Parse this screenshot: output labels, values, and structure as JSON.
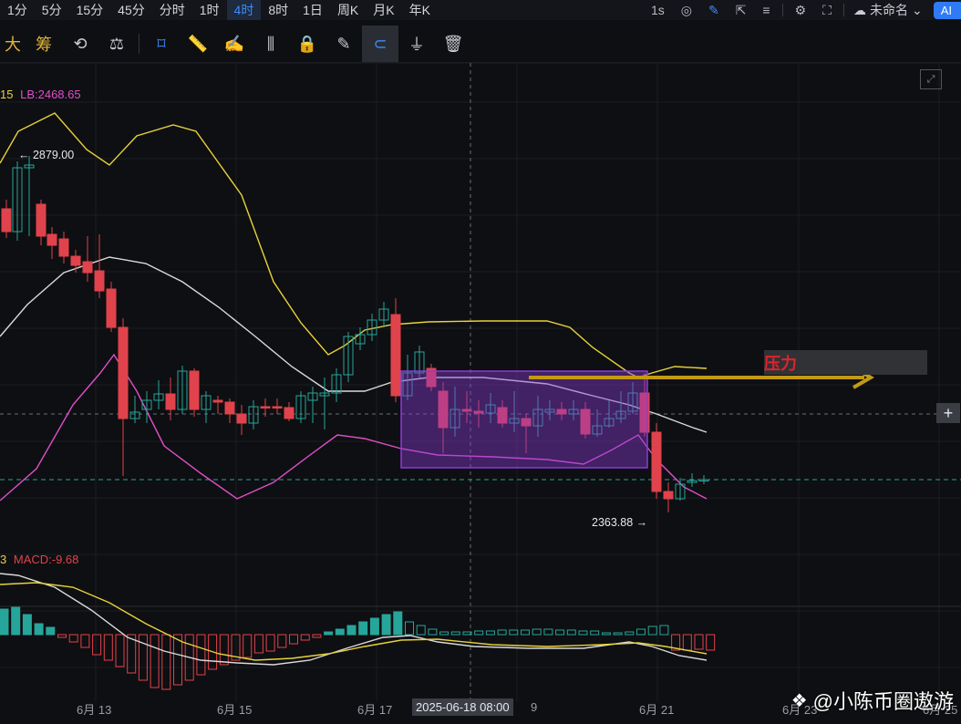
{
  "toolbar": {
    "intervals": [
      "1分",
      "5分",
      "15分",
      "45分",
      "分时",
      "1时",
      "4时",
      "8时",
      "1日",
      "周K",
      "月K",
      "年K"
    ],
    "active_interval": "4时",
    "right_speed": "1s",
    "layout_name": "未命名",
    "ai_label": "AI"
  },
  "drawing_tools": {
    "t_da": "大",
    "t_chou": "筹"
  },
  "chart": {
    "boll_legend": "15",
    "lb_legend": "LB:2468.65",
    "macd_prefix": "3",
    "macd_legend": "MACD:-9.68",
    "high_label": "2879.00",
    "low_label": "2363.88",
    "pressure_label": "压力",
    "crosshair_date": "2025-06-18 08:00",
    "x_labels": [
      "6月 13",
      "6月 15",
      "6月 17",
      "9",
      "6月 21",
      "6月 23",
      "6月 25"
    ],
    "colors": {
      "up": "#26a69a",
      "down": "#e0434b",
      "upper_band": "#e8d23a",
      "middle_band": "#d9d9d9",
      "lower_band": "#e04fc9",
      "box": "#8a3cd6",
      "arrow": "#c49a12"
    }
  },
  "watermark": {
    "text": "@小陈币圈遨游"
  }
}
